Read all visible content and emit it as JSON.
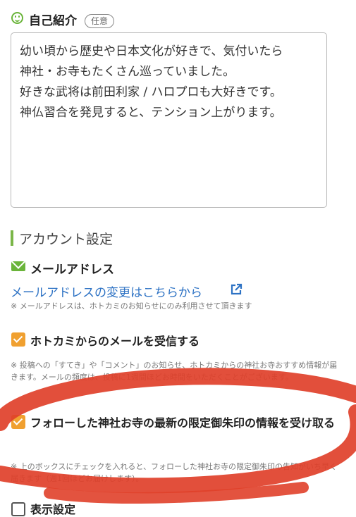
{
  "intro": {
    "title": "自己紹介",
    "badge": "任意",
    "bio_lines": [
      "幼い頃から歴史や日本文化が好きで、気付いたら",
      "神社・お寺もたくさん巡っていました。",
      "好きな武将は前田利家 / ハロプロも大好きです。",
      "神仏習合を発見すると、テンション上がります。"
    ]
  },
  "account": {
    "section_title": "アカウント設定",
    "mail_title": "メールアドレス",
    "mail_link": "メールアドレスの変更はこちらから",
    "mail_note": "※ メールアドレスは、ホトカミのお知らせにのみ利用させて頂きます"
  },
  "options": [
    {
      "label": "ホトカミからのメールを受信する",
      "note": "※ 投稿への「すてき」や「コメント」のお知らせ、ホトカミからの神社お寺おすすめ情報が届きます。メールの頻度は、投稿に1週間ほどお時間をいただくことがございます。"
    },
    {
      "label": "フォローした神社お寺の最新の限定御朱印の情報を受け取る",
      "note": "※ 上のボックスにチェックを入れると、フォローした神社お寺の限定御朱印の告知がいち早く届きます（週1回ほどお届けします）。"
    }
  ],
  "next_section": "表示設定",
  "colors": {
    "accent_green": "#6ab43a",
    "link_blue": "#2d72c4",
    "checkbox_orange": "#f0a030",
    "marker_red": "#e0402a"
  }
}
